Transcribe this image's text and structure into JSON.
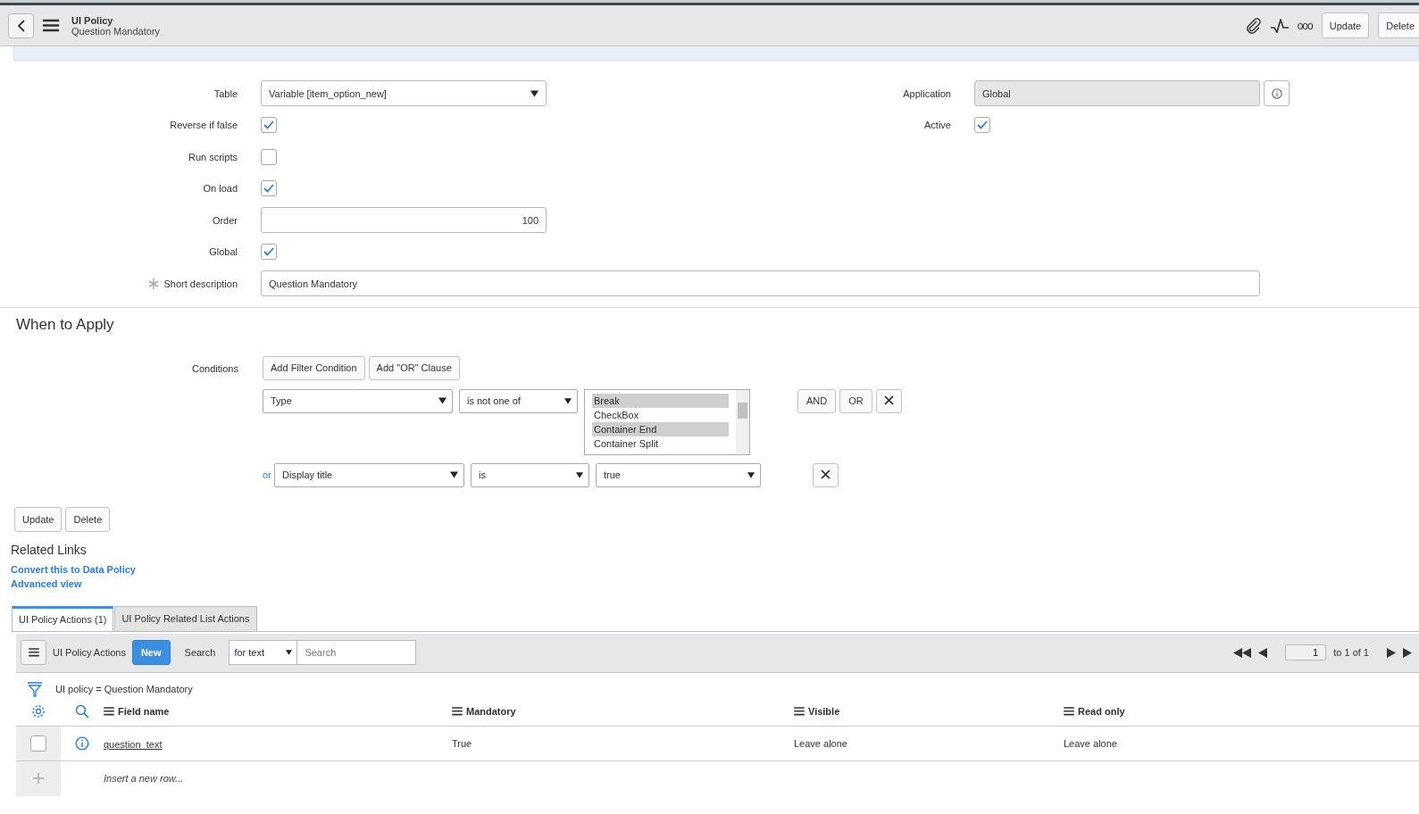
{
  "header": {
    "title": "UI Policy",
    "subtitle": "Question Mandatory",
    "buttons": [
      "Update",
      "Delete"
    ],
    "more": "ooo"
  },
  "form": {
    "left": [
      {
        "kind": "select",
        "label": "Table",
        "value": "Variable [item_option_new]"
      },
      {
        "kind": "checkbox",
        "label": "Reverse if false",
        "checked": true
      },
      {
        "kind": "checkbox",
        "label": "Run scripts",
        "checked": false
      },
      {
        "kind": "checkbox",
        "label": "On load",
        "checked": true
      },
      {
        "kind": "number",
        "label": "Order",
        "value": "100"
      },
      {
        "kind": "checkbox",
        "label": "Global",
        "checked": true
      }
    ],
    "right": [
      {
        "kind": "readonly",
        "label": "Application",
        "value": "Global"
      },
      {
        "kind": "checkbox",
        "label": "Active",
        "checked": true
      }
    ],
    "short_description": {
      "label": "Short description",
      "value": "Question Mandatory",
      "required": true
    }
  },
  "when_to_apply": {
    "title": "When to Apply",
    "label": "Conditions",
    "buttons": [
      "Add Filter Condition",
      "Add \"OR\" Clause"
    ],
    "conditions": [
      {
        "field": "Type",
        "operator": "is not one of",
        "kind": "list",
        "options": [
          {
            "label": "Break",
            "selected": true
          },
          {
            "label": "CheckBox",
            "selected": false
          },
          {
            "label": "Container End",
            "selected": true
          },
          {
            "label": "Container Split",
            "selected": false
          }
        ],
        "buttons": [
          "AND",
          "OR"
        ]
      },
      {
        "connector": "or",
        "field": "Display title",
        "operator": "is",
        "kind": "select",
        "value": "true"
      }
    ]
  },
  "form_buttons": [
    "Update",
    "Delete"
  ],
  "related_links": {
    "title": "Related Links",
    "links": [
      "Convert this to Data Policy",
      "Advanced view"
    ]
  },
  "tabs": [
    {
      "label": "UI Policy Actions (1)",
      "selected": true
    },
    {
      "label": "UI Policy Related List Actions",
      "selected": false
    }
  ],
  "list": {
    "title": "UI Policy Actions",
    "new_button": "New",
    "search_label": "Search",
    "search_mode": "for text",
    "search_placeholder": "Search",
    "page": "1",
    "page_total": "to 1 of 1",
    "filter": "UI policy = Question Mandatory",
    "columns": [
      "Field name",
      "Mandatory",
      "Visible",
      "Read only"
    ],
    "rows": [
      {
        "selected": false,
        "cells": [
          "question_text",
          "True",
          "Leave alone",
          "Leave alone"
        ]
      }
    ],
    "insert_row": "Insert a new row..."
  }
}
